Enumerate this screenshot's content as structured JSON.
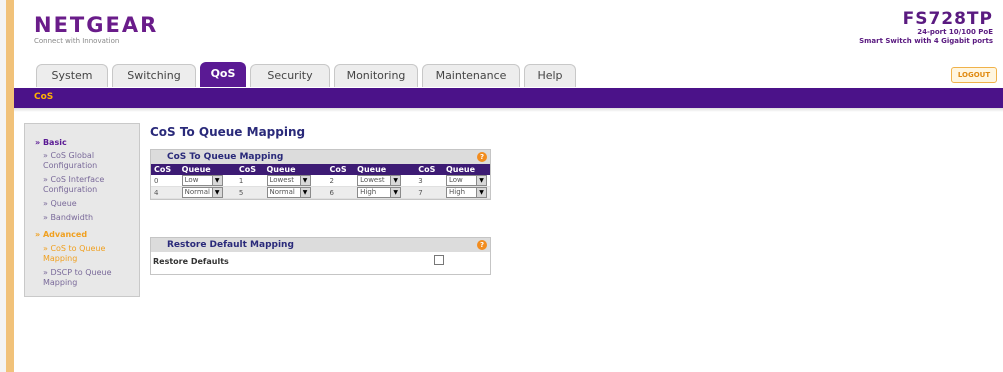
{
  "brand": {
    "name": "NETGEAR",
    "tagline": "Connect with Innovation"
  },
  "model": {
    "name": "FS728TP",
    "line1": "24-port 10/100 PoE",
    "line2": "Smart Switch with 4 Gigabit ports"
  },
  "tabs": [
    {
      "label": "System",
      "active": false
    },
    {
      "label": "Switching",
      "active": false
    },
    {
      "label": "QoS",
      "active": true
    },
    {
      "label": "Security",
      "active": false
    },
    {
      "label": "Monitoring",
      "active": false
    },
    {
      "label": "Maintenance",
      "active": false
    },
    {
      "label": "Help",
      "active": false
    }
  ],
  "logout_label": "LOGOUT",
  "subnav": "CoS",
  "sidebar": {
    "basic_header": "Basic",
    "basic_items": [
      "CoS Global Configuration",
      "CoS Interface Configuration",
      "Queue",
      "Bandwidth"
    ],
    "advanced_header": "Advanced",
    "advanced_items": [
      "CoS to Queue Mapping",
      "DSCP to Queue Mapping"
    ]
  },
  "page_title": "CoS To Queue Mapping",
  "mapping_box": {
    "title": "CoS To Queue Mapping",
    "headers": [
      "CoS",
      "Queue",
      "CoS",
      "Queue",
      "CoS",
      "Queue",
      "CoS",
      "Queue"
    ],
    "rows": [
      [
        {
          "cos": "0",
          "queue": "Low"
        },
        {
          "cos": "1",
          "queue": "Lowest"
        },
        {
          "cos": "2",
          "queue": "Lowest"
        },
        {
          "cos": "3",
          "queue": "Low"
        }
      ],
      [
        {
          "cos": "4",
          "queue": "Normal"
        },
        {
          "cos": "5",
          "queue": "Normal"
        },
        {
          "cos": "6",
          "queue": "High"
        },
        {
          "cos": "7",
          "queue": "High"
        }
      ]
    ]
  },
  "restore_box": {
    "title": "Restore Default Mapping",
    "row_label": "Restore Defaults",
    "checked": false
  },
  "icons": {
    "help": "help-icon",
    "dropdown": "chevron-down-icon",
    "bullet": "triangle-right-icon"
  },
  "colors": {
    "brand_purple": "#4b1289",
    "accent_orange": "#f0a020",
    "table_header": "#3d1b74"
  }
}
